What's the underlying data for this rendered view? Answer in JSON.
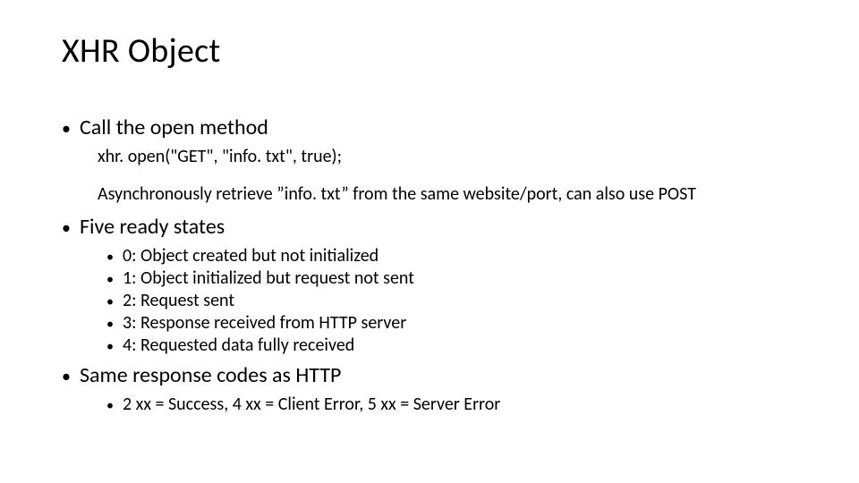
{
  "title": "XHR Object",
  "items": [
    {
      "label": "Call the open method",
      "code": "xhr. open(\"GET\", \"info. txt\", true);",
      "note": "Asynchronously retrieve ”info. txt” from the same website/port, can also use POST"
    },
    {
      "label": "Five ready states",
      "sub": [
        "0: Object created but not initialized",
        "1: Object initialized but request not sent",
        "2: Request sent",
        "3: Response received from HTTP server",
        "4: Requested data fully received"
      ]
    },
    {
      "label": "Same response codes as HTTP",
      "sub": [
        "2 xx  = Success, 4 xx = Client Error, 5 xx = Server Error"
      ]
    }
  ]
}
